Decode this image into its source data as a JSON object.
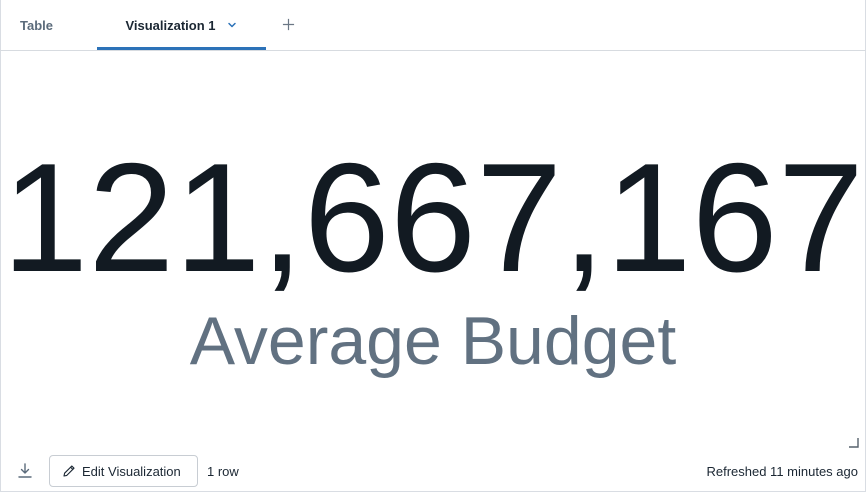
{
  "tabs": [
    {
      "label": "Table",
      "active": false
    },
    {
      "label": "Visualization 1",
      "active": true
    }
  ],
  "add_tab_icon": "plus-icon",
  "counter": {
    "value": "121,667,167",
    "label": "Average Budget"
  },
  "footer": {
    "download_icon": "download-icon",
    "edit_button": "Edit Visualization",
    "row_count": "1 row",
    "refreshed": "Refreshed 11 minutes ago"
  },
  "colors": {
    "accent": "#2c72b8",
    "value_text": "#121a22",
    "label_text": "#617181"
  }
}
